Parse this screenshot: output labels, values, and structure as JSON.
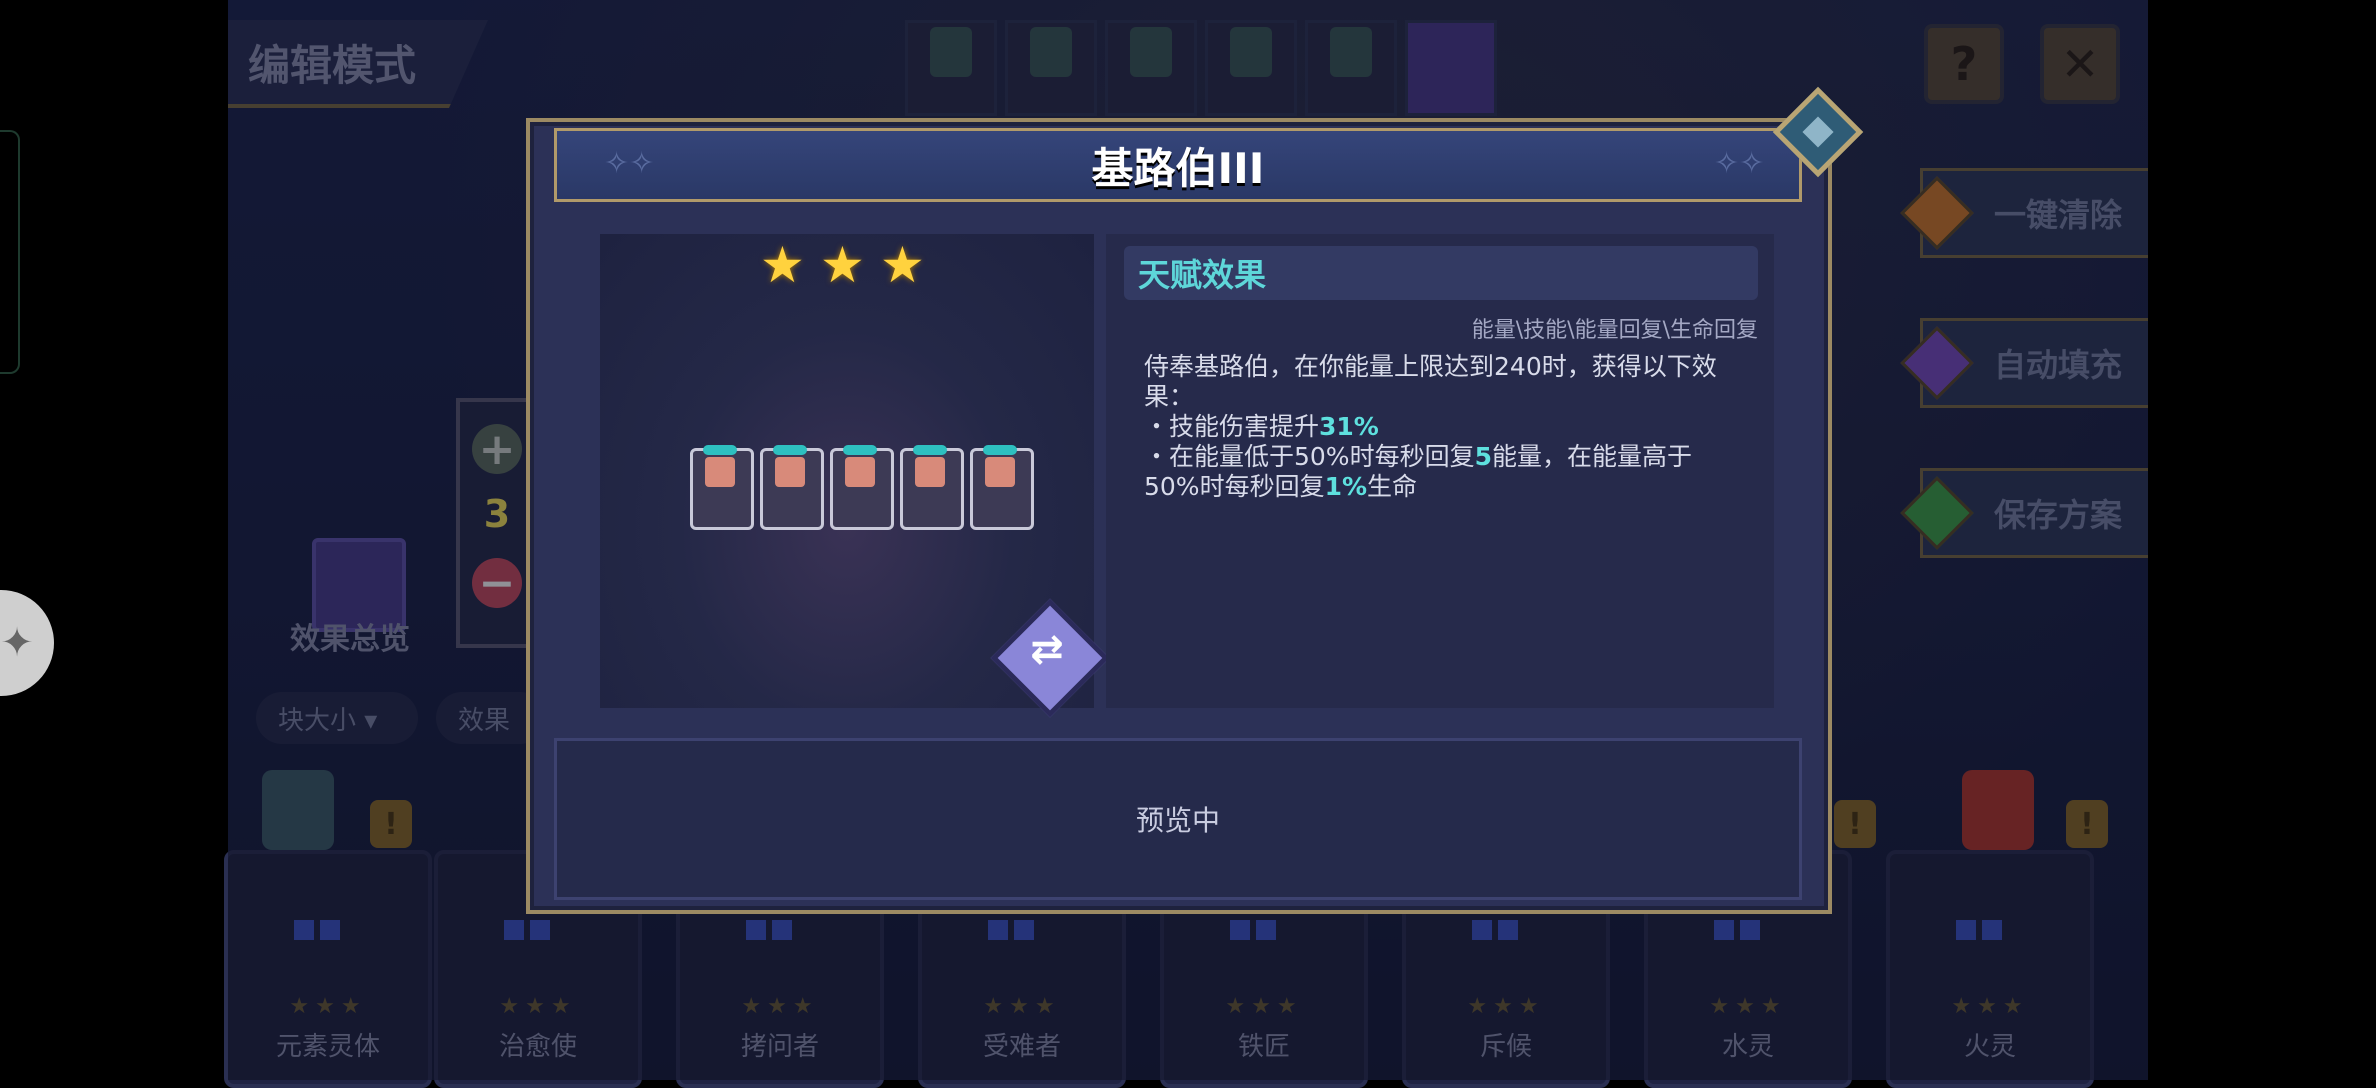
{
  "top_bar": {
    "edit_mode": "编辑模式",
    "help": "?",
    "close": "✕"
  },
  "side_buttons": [
    {
      "label": "一键清除",
      "gem_color": "#d27b2c"
    },
    {
      "label": "自动填充",
      "gem_color": "#7b4ec4"
    },
    {
      "label": "保存方案",
      "gem_color": "#3ea34a"
    }
  ],
  "effects_overview": "效果总览",
  "counter": {
    "plus": "+",
    "value": "3",
    "minus": "−"
  },
  "filters": {
    "block_size": "块大小 ▾",
    "effect": "效果"
  },
  "cards": [
    {
      "name": "元素灵体",
      "stars": "★★★"
    },
    {
      "name": "治愈使",
      "stars": "★★★"
    },
    {
      "name": "拷问者",
      "stars": "★★★"
    },
    {
      "name": "受难者",
      "stars": "★★★"
    },
    {
      "name": "铁匠",
      "stars": "★★★"
    },
    {
      "name": "斥候",
      "stars": "★★★"
    },
    {
      "name": "水灵",
      "stars": "★★★"
    },
    {
      "name": "火灵",
      "stars": "★★★"
    }
  ],
  "modal": {
    "title": "基路伯III",
    "stars": [
      "★",
      "★",
      "★"
    ],
    "hero_count": 5,
    "talent_title": "天赋效果",
    "tags": "能量\\技能\\能量回复\\生命回复",
    "desc_line1": "侍奉基路伯，在你能量上限达到240时，获得以下效果：",
    "bullet1_pre": "・技能伤害提升",
    "bullet1_val": "31%",
    "bullet2_pre": "・在能量低于50%时每秒回复",
    "bullet2_val1": "5",
    "bullet2_mid": "能量，在能量高于50%时每秒回复",
    "bullet2_val2": "1%",
    "bullet2_post": "生命",
    "preview": "预览中"
  },
  "colors": {
    "highlight": "#5ee0de",
    "star": "#ffd23e",
    "frame_gold": "#9c8a63"
  }
}
